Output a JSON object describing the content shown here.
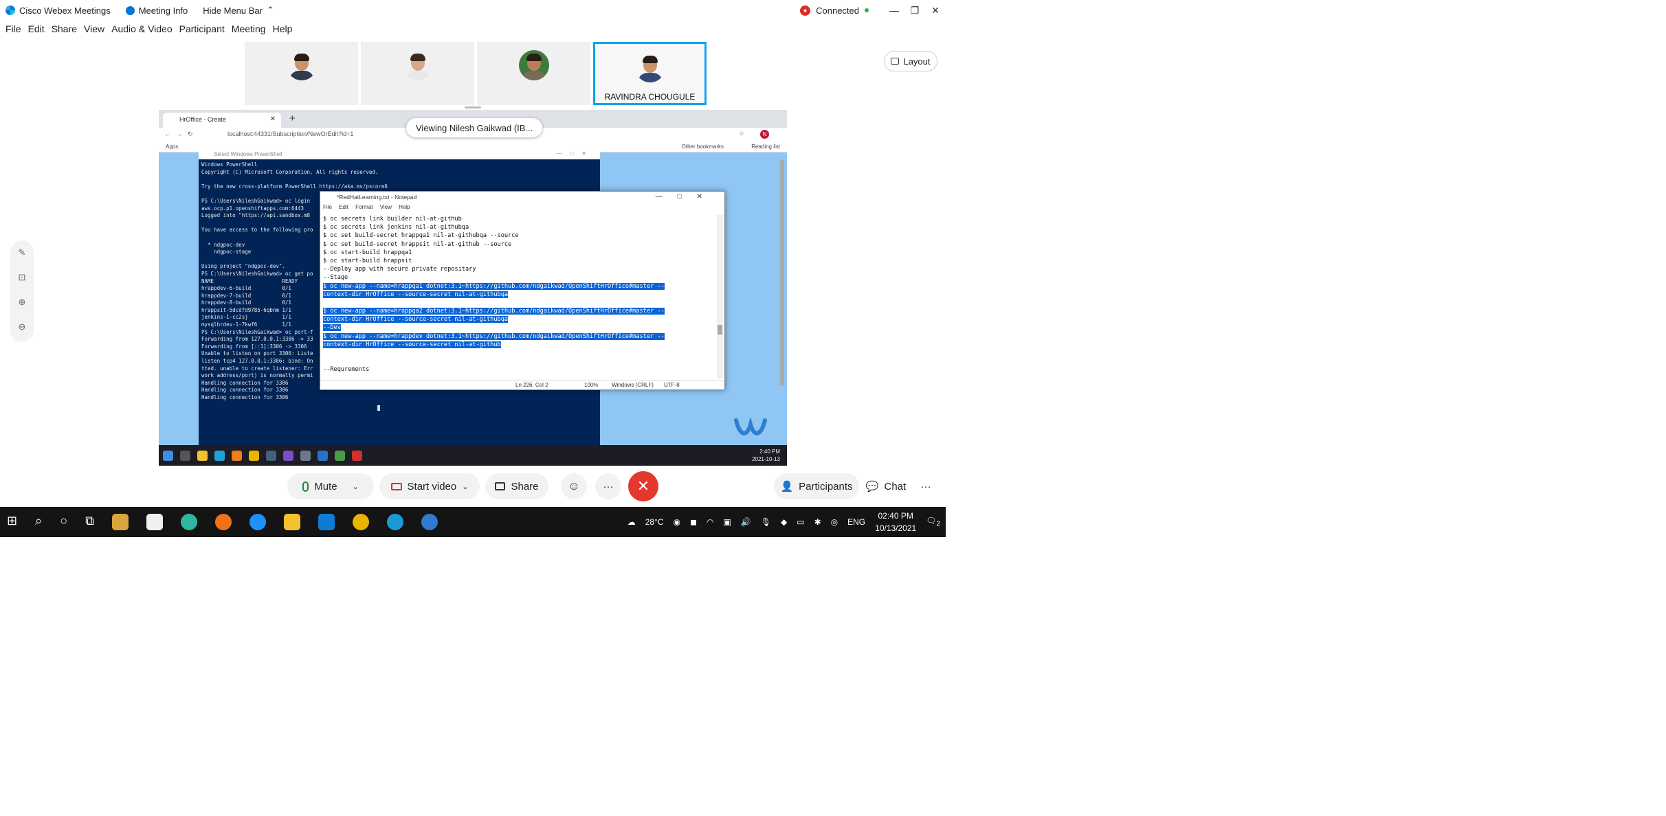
{
  "window": {
    "app_title": "Cisco Webex Meetings",
    "meeting_info": "Meeting Info",
    "hide_menu_bar": "Hide Menu Bar",
    "connection_status": "Connected"
  },
  "menu": [
    "File",
    "Edit",
    "Share",
    "View",
    "Audio & Video",
    "Participant",
    "Meeting",
    "Help"
  ],
  "participants": {
    "active_name": "RAVINDRA CHOUGULE",
    "layout_label": "Layout"
  },
  "share": {
    "viewing_label": "Viewing Nilesh Gaikwad (IB...",
    "browser": {
      "tab_title": "HrOffice - Create",
      "url": "localhost:44331/Subscription/NewOrEdit?id=1",
      "profile_initial": "N",
      "bookmark_apps": "Apps",
      "bookmark_other": "Other bookmarks",
      "bookmark_reading": "Reading list"
    },
    "powershell": {
      "title": "Select Windows PowerShell",
      "lines": [
        "Windows PowerShell",
        "Copyright (C) Microsoft Corporation. All rights reserved.",
        "",
        "Try the new cross-platform PowerShell https://aka.ms/pscore6",
        "",
        "PS C:\\Users\\NileshGaikwad> oc login",
        "aws.ocp.p1.openshiftapps.com:6443",
        "Logged into \"https://api.sandbox.m8",
        "",
        "You have access to the following pro",
        "",
        "  * ndgpoc-dev",
        "    ndgpoc-stage",
        "",
        "Using project \"ndgpoc-dev\".",
        "PS C:\\Users\\NileshGaikwad> oc get po",
        "NAME                      READY",
        "hrappdev-6-build          0/1",
        "hrappdev-7-build          0/1",
        "hrappdev-8-build          0/1",
        "hrappsit-5dcdfd9785-6qbnm 1/1",
        "jenkins-1-cc2sj           1/1",
        "mysqlhrdev-1-7kwf6        1/1",
        "PS C:\\Users\\NileshGaikwad> oc port-f",
        "Forwarding from 127.0.0.1:3306 -> 33",
        "Forwarding from [::1]:3306 -> 3306",
        "Unable to listen on port 3306: Liste",
        "listen tcp4 127.0.0.1:3306: bind: On",
        "tted. unable to create listener: Err",
        "work address/port) is normally permi",
        "Handling connection for 3306",
        "Handling connection for 3306",
        "Handling connection for 3306"
      ]
    },
    "notepad": {
      "title": "*RedHatLearning.txt - Notepad",
      "menu": [
        "File",
        "Edit",
        "Format",
        "View",
        "Help"
      ],
      "lines": [
        {
          "text": "$ oc secrets link builder nil-at-github",
          "hl": false
        },
        {
          "text": "$ oc secrets link jenkins nil-at-githubqa",
          "hl": false
        },
        {
          "text": "$ oc set build-secret hrappqa1 nil-at-githubqa --source",
          "hl": false
        },
        {
          "text": "$ oc set build-secret hrappsit nil-at-github --source",
          "hl": false
        },
        {
          "text": "$ oc start-build hrappqa1",
          "hl": false
        },
        {
          "text": "$ oc start-build hrappsit",
          "hl": false
        },
        {
          "text": "--Deploy app with secure private repositary",
          "hl": false
        },
        {
          "text": "--Stage",
          "hl": false
        },
        {
          "text": "$ oc new-app --name=hrappqa1 dotnet:3.1~https://github.com/ndgaikwad/OpenShiftHrOffice#master --",
          "hl": true
        },
        {
          "text": "context-dir HrOffice --source-secret nil-at-githubqa",
          "hl": true
        },
        {
          "text": "",
          "hl": false
        },
        {
          "text": "$ oc new-app --name=hrappqa2 dotnet:3.1~https://github.com/ndgaikwad/OpenShiftHrOffice#master --",
          "hl": true
        },
        {
          "text": "context-dir HrOffice --source-secret nil-at-githubqa",
          "hl": true
        },
        {
          "text": "--Dev",
          "hl": true
        },
        {
          "text": "$ oc new-app --name=hrappdev dotnet:3.1~https://github.com/ndgaikwad/OpenShiftHrOffice#master --",
          "hl": true
        },
        {
          "text": "context-dir HrOffice --source-secret nil-at-github",
          "hl": true
        },
        {
          "text": "",
          "hl": false
        },
        {
          "text": "",
          "hl": false
        },
        {
          "text": "--Requrements",
          "hl": false
        }
      ],
      "status_pos": "Ln 226, Col 2",
      "status_zoom": "100%",
      "status_eol": "Windows (CRLF)",
      "status_enc": "UTF-8"
    },
    "remote_clock": {
      "time": "2:40 PM",
      "date": "2021-10-13"
    }
  },
  "controls": {
    "mute": "Mute",
    "start_video": "Start video",
    "share": "Share",
    "participants": "Participants",
    "chat": "Chat"
  },
  "taskbar": {
    "weather": "28°C",
    "language": "ENG",
    "time": "02:40 PM",
    "date": "10/13/2021",
    "notifications": "2"
  }
}
